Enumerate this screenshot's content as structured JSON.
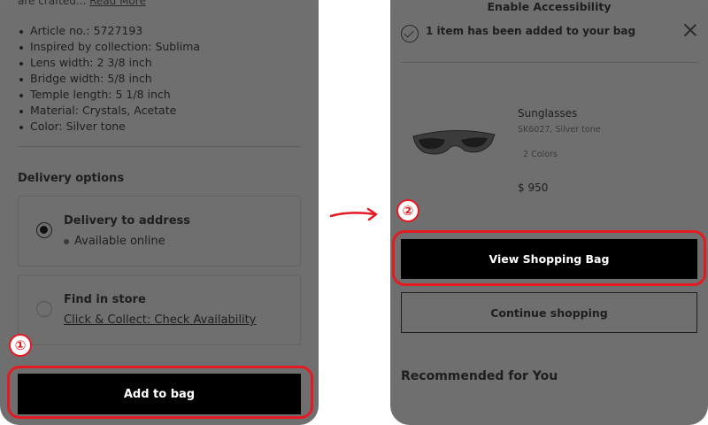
{
  "left": {
    "cut_text": "are crafted...",
    "cut_link": "Read More",
    "specs": [
      "Article no.: 5727193",
      "Inspired by collection:  Sublima",
      "Lens width: 2 3/8 inch",
      "Bridge width: 5/8 inch",
      "Temple length: 5 1/8 inch",
      "Material:  Crystals, Acetate",
      "Color:  Silver tone"
    ],
    "delivery_title": "Delivery options",
    "option1": {
      "label": "Delivery to address",
      "sub": "Available online"
    },
    "option2": {
      "label": "Find in store",
      "sub": "Click & Collect: Check Availability"
    },
    "add_to_bag": "Add to bag",
    "step_badge": "①"
  },
  "right": {
    "accessibility": "Enable Accessibility",
    "notice": "1 item has been added to your bag",
    "product": {
      "name": "Sunglasses",
      "sku": "SK6027, Silver tone",
      "colors": "2 Colors",
      "price": "$ 950"
    },
    "view_bag": "View Shopping Bag",
    "continue": "Continue shopping",
    "recommended": "Recommended for You",
    "step_badge": "②"
  },
  "colors": {
    "highlight": "#e51b23",
    "overlay": "#6f6f6f",
    "button": "#000000"
  }
}
